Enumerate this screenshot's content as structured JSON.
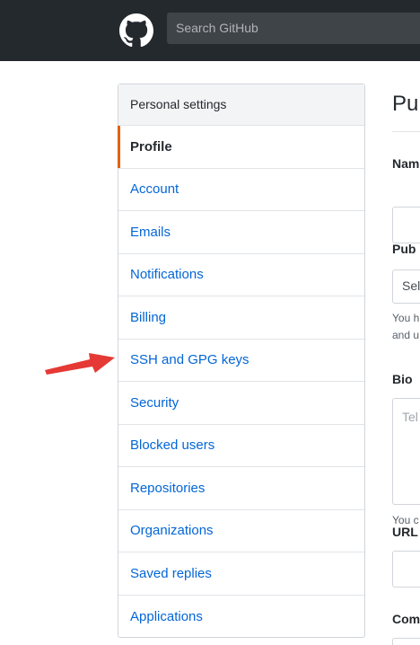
{
  "header": {
    "search_placeholder": "Search GitHub"
  },
  "sidebar": {
    "heading": "Personal settings",
    "items": [
      {
        "label": "Profile",
        "selected": true
      },
      {
        "label": "Account"
      },
      {
        "label": "Emails"
      },
      {
        "label": "Notifications"
      },
      {
        "label": "Billing"
      },
      {
        "label": "SSH and GPG keys"
      },
      {
        "label": "Security"
      },
      {
        "label": "Blocked users"
      },
      {
        "label": "Repositories"
      },
      {
        "label": "Organizations"
      },
      {
        "label": "Saved replies"
      },
      {
        "label": "Applications"
      }
    ]
  },
  "main": {
    "title": "Pu",
    "name_label": "Nam",
    "public_email_label": "Pub",
    "public_email_select": "Sel",
    "public_email_note_1": "You h",
    "public_email_note_2": "and u",
    "bio_label": "Bio",
    "bio_placeholder": "Tel",
    "bio_note": "You c",
    "url_label": "URL",
    "company_label": "Com"
  },
  "annotation": {
    "arrow_color": "#e53935"
  },
  "colors": {
    "header_bg": "#24292e",
    "link": "#0366d6",
    "selected_marker": "#e36209"
  }
}
